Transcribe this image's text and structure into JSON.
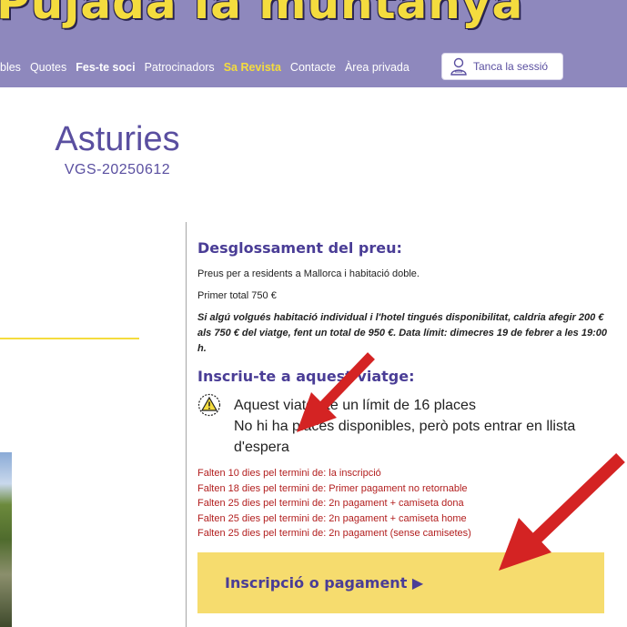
{
  "header": {
    "brand": "Pujada la muntanya",
    "nav": [
      "bles",
      "Quotes",
      "Fes-te soci",
      "Patrocinadors",
      "Sa Revista",
      "Contacte",
      "Àrea privada"
    ],
    "logout_label": "Tanca la sessió"
  },
  "trip": {
    "title": "Asturies",
    "code": "VGS-20250612"
  },
  "price": {
    "heading": "Desglossament del preu:",
    "residents": "Preus per a residents a Mallorca i habitació doble.",
    "first_total": "Primer total 750 €",
    "note": "Si algú volgués habitació individual i l'hotel tingués disponibilitat, caldria afegir 200 € als 750 € del viatge, fent un total de 950 €. Data límit: dimecres 19 de febrer a les 19:00 h."
  },
  "signup": {
    "heading": "Inscriu-te a aquest viatge:",
    "limit_line1": "Aquest viatge té un límit de 16 places",
    "limit_line2": "No hi ha places disponibles, però pots entrar en llista d'espera",
    "deadlines": [
      "Falten 10 dies pel termini de: la inscripció",
      "Falten 18 dies pel termini de: Primer pagament no retornable",
      "Falten 25 dies pel termini de: 2n pagament + camiseta dona",
      "Falten 25 dies pel termini de: 2n pagament + camiseta home",
      "Falten 25 dies pel termini de: 2n pagament (sense camisetes)"
    ],
    "cta_label": "Inscripció o pagament ▶"
  },
  "colors": {
    "header_bg": "#8e88bd",
    "brand": "#f4dc3e",
    "accent": "#4a3d96",
    "deadline_text": "#b21e1e",
    "cta_bg": "#f6dc6e",
    "annotation_arrow": "#d42323"
  },
  "icons": [
    "user-icon",
    "warning-people-icon",
    "annotation-arrow"
  ]
}
